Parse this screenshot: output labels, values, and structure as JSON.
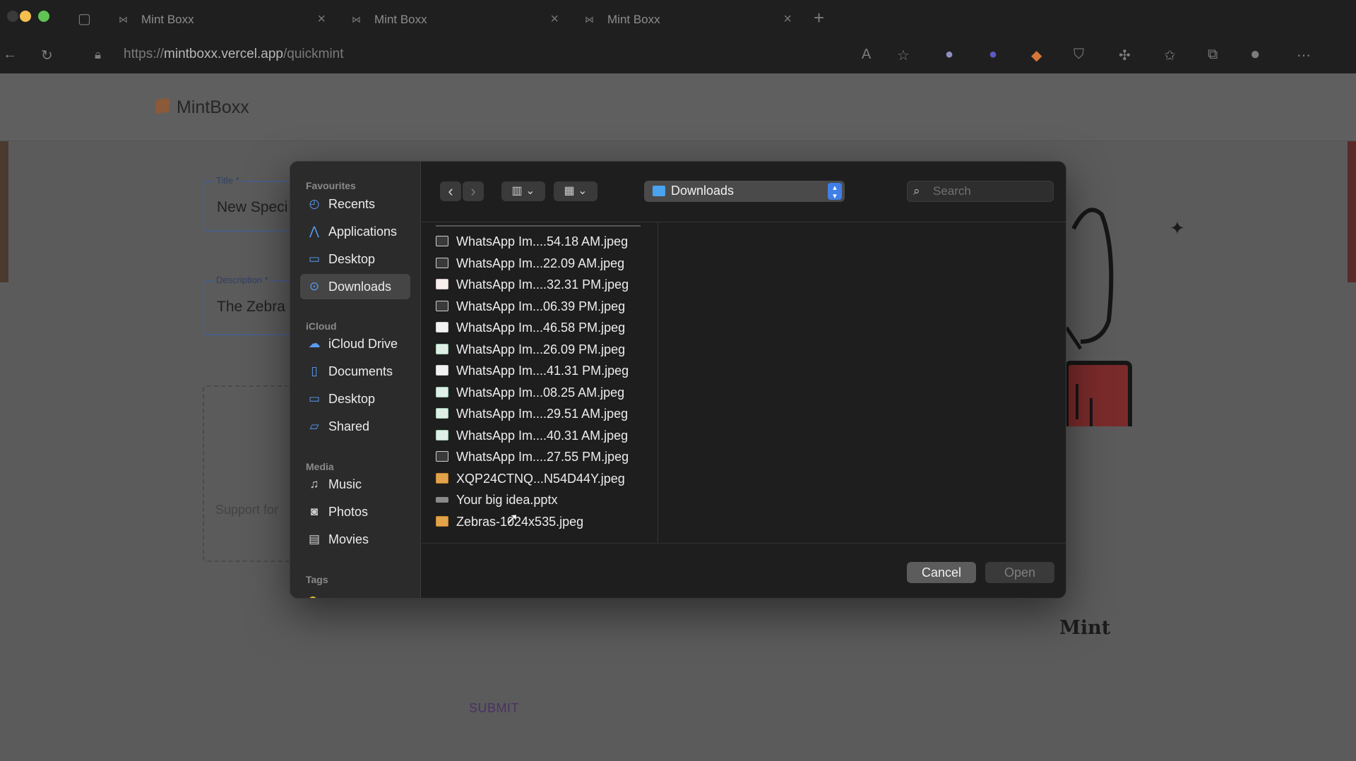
{
  "browser": {
    "tabs": [
      {
        "title": "Mint Boxx"
      },
      {
        "title": "Mint Boxx"
      },
      {
        "title": "Mint Boxx"
      }
    ],
    "url_prefix": "https://",
    "url_host": "mintboxx.vercel.app",
    "url_path": "/quickmint"
  },
  "site": {
    "logo_text": "MintBoxx",
    "title_label": "Title *",
    "title_value": "New Speci",
    "description_label": "Description *",
    "description_value": "The Zebra",
    "dropzone_text": "Support for",
    "submit_label": "SUBMIT",
    "mint_text": "Mint"
  },
  "dialog": {
    "sidebar": {
      "favourites_heading": "Favourites",
      "favourites": [
        {
          "label": "Recents",
          "icon": "clock-icon"
        },
        {
          "label": "Applications",
          "icon": "applications-icon"
        },
        {
          "label": "Desktop",
          "icon": "desktop-icon"
        },
        {
          "label": "Downloads",
          "icon": "downloads-icon",
          "selected": true
        }
      ],
      "icloud_heading": "iCloud",
      "icloud": [
        {
          "label": "iCloud Drive",
          "icon": "cloud-icon"
        },
        {
          "label": "Documents",
          "icon": "document-icon"
        },
        {
          "label": "Desktop",
          "icon": "desktop-icon"
        },
        {
          "label": "Shared",
          "icon": "shared-folder-icon"
        }
      ],
      "media_heading": "Media",
      "media": [
        {
          "label": "Music",
          "icon": "music-icon"
        },
        {
          "label": "Photos",
          "icon": "camera-icon"
        },
        {
          "label": "Movies",
          "icon": "film-icon"
        }
      ],
      "tags_heading": "Tags"
    },
    "toolbar": {
      "back_icon": "‹",
      "forward_icon": "›",
      "view_icon": "▥ ⌄",
      "group_icon": "▦ ⌄",
      "location": "Downloads",
      "search_placeholder": "Search"
    },
    "files": [
      {
        "name": "WhatsApp Im....54.18 AM.jpeg",
        "icon": "dark"
      },
      {
        "name": "WhatsApp Im...22.09 AM.jpeg",
        "icon": "dark"
      },
      {
        "name": "WhatsApp Im....32.31 PM.jpeg",
        "icon": "pink"
      },
      {
        "name": "WhatsApp Im...06.39 PM.jpeg",
        "icon": "dark"
      },
      {
        "name": "WhatsApp Im...46.58 PM.jpeg",
        "icon": "white"
      },
      {
        "name": "WhatsApp Im...26.09 PM.jpeg",
        "icon": "green"
      },
      {
        "name": "WhatsApp Im....41.31 PM.jpeg",
        "icon": "white"
      },
      {
        "name": "WhatsApp Im...08.25 AM.jpeg",
        "icon": "green"
      },
      {
        "name": "WhatsApp Im....29.51 AM.jpeg",
        "icon": "green"
      },
      {
        "name": "WhatsApp Im....40.31 AM.jpeg",
        "icon": "green"
      },
      {
        "name": "WhatsApp Im....27.55 PM.jpeg",
        "icon": "dark"
      },
      {
        "name": "XQP24CTNQ...N54D44Y.jpeg",
        "icon": "orange"
      },
      {
        "name": "Your big idea.pptx",
        "icon": "gray"
      },
      {
        "name": "Zebras-1024x535.jpeg",
        "icon": "orange"
      }
    ],
    "cancel_label": "Cancel",
    "open_label": "Open"
  }
}
